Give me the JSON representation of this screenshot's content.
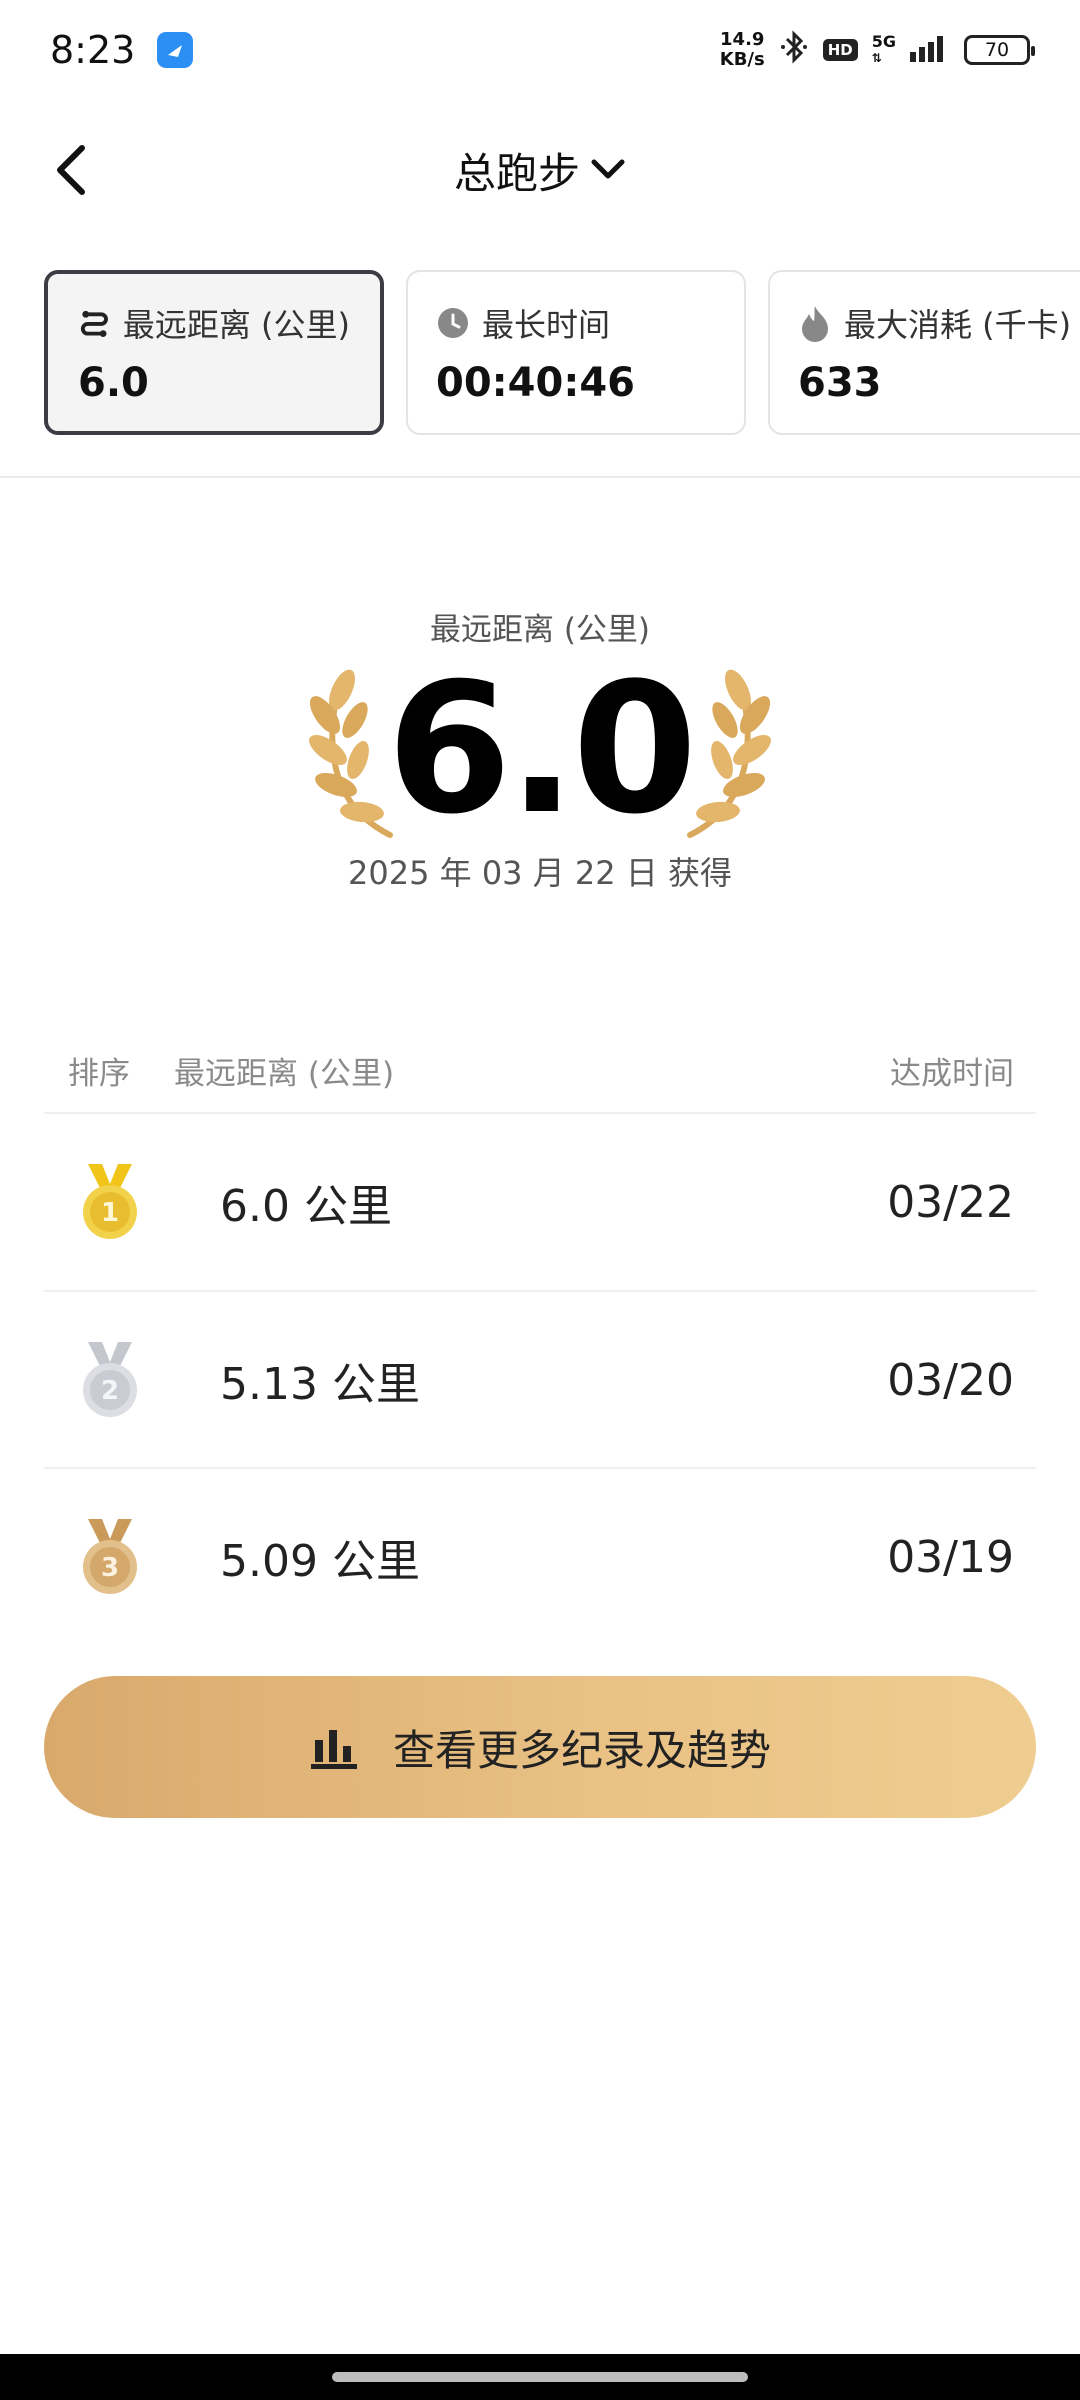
{
  "status_bar": {
    "time": "8:23",
    "net_speed_value": "14.9",
    "net_speed_unit": "KB/s",
    "hd": "HD",
    "network": "5G",
    "battery": "70"
  },
  "header": {
    "title": "总跑步"
  },
  "tabs": [
    {
      "label": "最远距离 (公里)",
      "value": "6.0",
      "icon": "route-icon"
    },
    {
      "label": "最长时间",
      "value": "00:40:46",
      "icon": "clock-icon"
    },
    {
      "label": "最大消耗 (千卡)",
      "value": "633",
      "icon": "flame-icon"
    }
  ],
  "hero": {
    "label": "最远距离 (公里)",
    "value": "6.0",
    "date": "2025 年 03 月 22 日 获得"
  },
  "table": {
    "headers": {
      "rank": "排序",
      "distance": "最远距离 (公里)",
      "time": "达成时间"
    },
    "rows": [
      {
        "rank": "1",
        "distance": "6.0 公里",
        "date": "03/22"
      },
      {
        "rank": "2",
        "distance": "5.13 公里",
        "date": "03/20"
      },
      {
        "rank": "3",
        "distance": "5.09 公里",
        "date": "03/19"
      }
    ]
  },
  "cta": {
    "label": "查看更多纪录及趋势"
  },
  "colors": {
    "gold": "#e8bd2f",
    "silver": "#c9ccd3",
    "bronze": "#d3a86a",
    "cta_start": "#d9a96c",
    "cta_end": "#efcd91",
    "laurel": "#d9a85a"
  }
}
